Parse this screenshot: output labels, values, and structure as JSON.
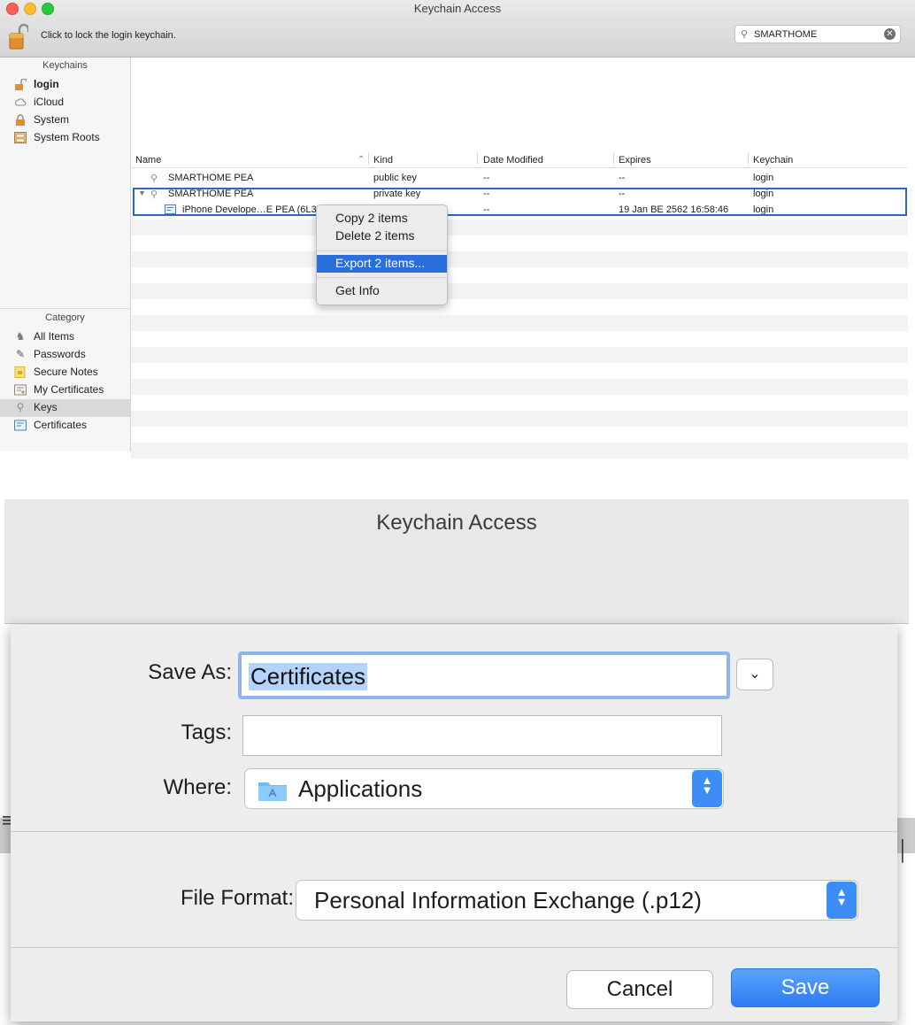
{
  "window": {
    "title": "Keychain Access",
    "lock_text": "Click to lock the login keychain.",
    "search_value": "SMARTHOME",
    "search_icon": "magnifier-icon",
    "clear_icon": "clear-circle-icon"
  },
  "sidebar": {
    "keychains_header": "Keychains",
    "keychains": [
      {
        "label": "login",
        "icon": "lock-open-icon"
      },
      {
        "label": "iCloud",
        "icon": "cloud-icon"
      },
      {
        "label": "System",
        "icon": "lock-icon"
      },
      {
        "label": "System Roots",
        "icon": "cabinet-icon"
      }
    ],
    "category_header": "Category",
    "categories": [
      {
        "label": "All Items",
        "icon": "all-items-icon"
      },
      {
        "label": "Passwords",
        "icon": "pen-icon"
      },
      {
        "label": "Secure Notes",
        "icon": "note-icon"
      },
      {
        "label": "My Certificates",
        "icon": "certificate-icon"
      },
      {
        "label": "Keys",
        "icon": "key-icon"
      },
      {
        "label": "Certificates",
        "icon": "certificate-icon"
      }
    ]
  },
  "table": {
    "columns": [
      "Name",
      "Kind",
      "Date Modified",
      "Expires",
      "Keychain"
    ],
    "rows": [
      {
        "name": "SMARTHOME PEA",
        "kind": "public key",
        "date": "--",
        "expires": "--",
        "keychain": "login"
      },
      {
        "name": "SMARTHOME PEA",
        "kind": "private key",
        "date": "--",
        "expires": "--",
        "keychain": "login"
      },
      {
        "name": "iPhone Develope…E PEA (6L3",
        "kind": "",
        "date": "--",
        "expires": "19 Jan BE 2562 16:58:46",
        "keychain": "login"
      }
    ]
  },
  "context_menu": {
    "copy": "Copy 2 items",
    "delete": "Delete 2 items",
    "export": "Export 2 items...",
    "info": "Get Info"
  },
  "dialog": {
    "title": "Keychain Access",
    "save_as_label": "Save As:",
    "save_as_value": "Certificates",
    "tags_label": "Tags:",
    "where_label": "Where:",
    "where_value": "Applications",
    "file_format_label": "File Format:",
    "file_format_value": "Personal Information Exchange (.p12)",
    "cancel_label": "Cancel",
    "save_label": "Save",
    "accent": "#3d8df6"
  }
}
